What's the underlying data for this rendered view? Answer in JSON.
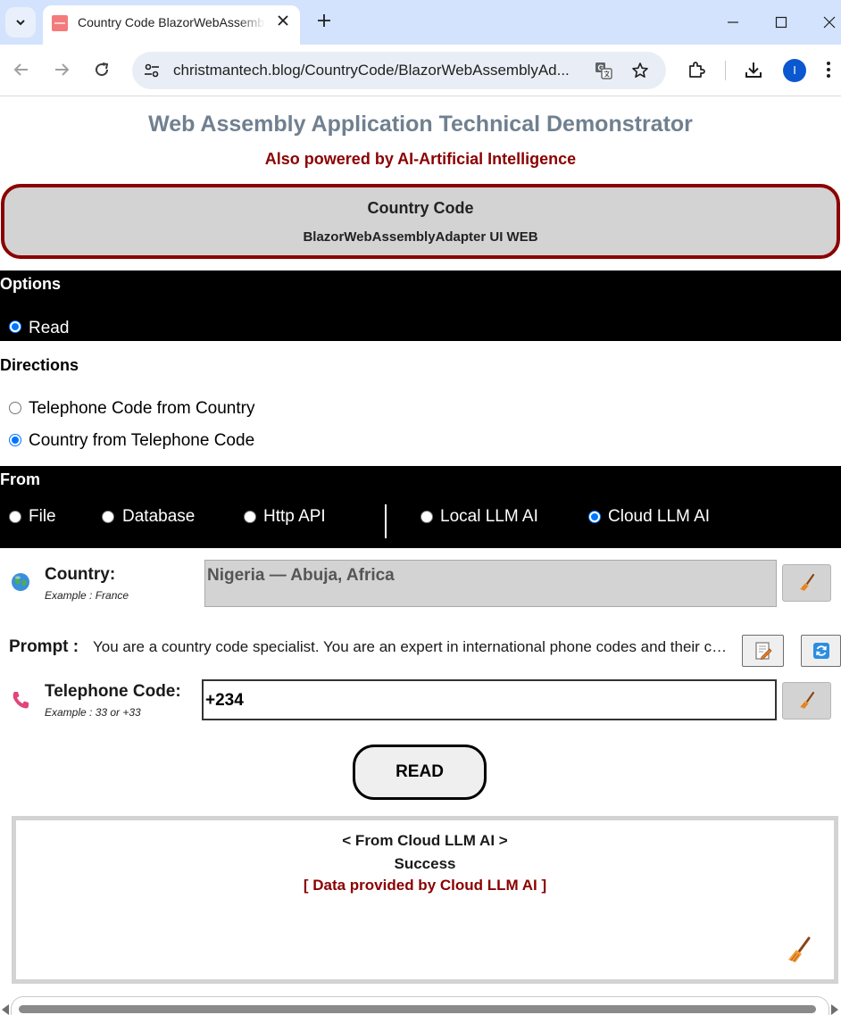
{
  "browser": {
    "tab_title": "Country Code BlazorWebAssemblyAdapter UI WEB",
    "url": "christmantech.blog/CountryCode/BlazorWebAssemblyAd...",
    "profile_initial": "I"
  },
  "header": {
    "title": "Web Assembly Application Technical Demonstrator",
    "subtitle": "Also powered by AI-Artificial Intelligence"
  },
  "banner": {
    "title": "Country Code",
    "subtitle": "BlazorWebAssemblyAdapter UI WEB"
  },
  "options": {
    "heading": "Options",
    "items": [
      {
        "label": "Read",
        "checked": true
      }
    ]
  },
  "directions": {
    "heading": "Directions",
    "items": [
      {
        "label": "Telephone Code from Country",
        "checked": false
      },
      {
        "label": "Country from Telephone Code",
        "checked": true
      }
    ]
  },
  "from": {
    "heading": "From",
    "items": [
      {
        "label": "File",
        "checked": false
      },
      {
        "label": "Database",
        "checked": false
      },
      {
        "label": "Http API",
        "checked": false
      },
      {
        "label": "Local LLM AI",
        "checked": false
      },
      {
        "label": "Cloud LLM AI",
        "checked": true
      }
    ]
  },
  "country": {
    "label": "Country:",
    "example": "Example : France",
    "value": "Nigeria — Abuja, Africa",
    "icon": "globe-icon"
  },
  "prompt": {
    "label": "Prompt :",
    "text": "You are a country code specialist. You are an expert in international phone codes and their countries."
  },
  "telephone": {
    "label": "Telephone Code:",
    "example": "Example : 33 or +33",
    "value": "+234",
    "icon": "phone-icon"
  },
  "read_button": {
    "label": "READ"
  },
  "result": {
    "source": "< From Cloud LLM AI >",
    "status": "Success",
    "note": "[ Data provided by Cloud LLM AI ]"
  },
  "colors": {
    "title": "#708090",
    "accent": "#8b0000",
    "radio_checked": "#0075ff",
    "band": "#000000",
    "banner_bg": "#d3d3d3"
  }
}
